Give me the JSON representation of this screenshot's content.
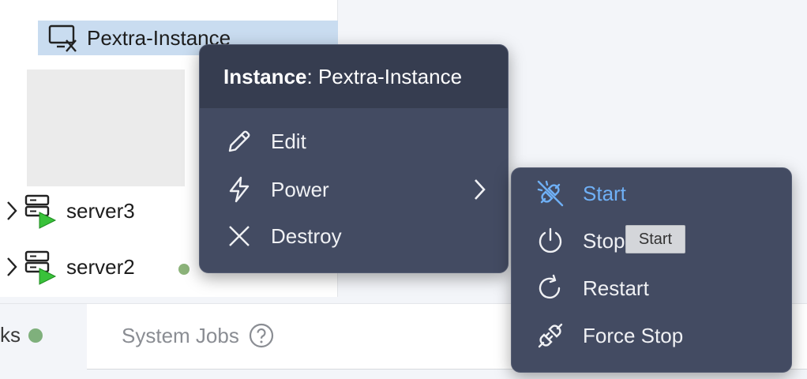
{
  "tree": {
    "selected_item": {
      "label": "Pextra-Instance",
      "icon": "monitor-x-icon"
    },
    "servers": [
      {
        "label": "server3",
        "icon": "server-running-icon"
      },
      {
        "label": "server2",
        "icon": "server-running-icon"
      }
    ]
  },
  "tabs": [
    {
      "label": "ks",
      "status": "green-dot"
    },
    {
      "label": "System Jobs",
      "icon": "help-circle-icon"
    }
  ],
  "context_menu": {
    "header_prefix": "Instance",
    "header_name": ": Pextra-Instance",
    "items": [
      {
        "label": "Edit",
        "icon": "pencil-icon"
      },
      {
        "label": "Power",
        "icon": "lightning-icon",
        "has_submenu": true
      },
      {
        "label": "Destroy",
        "icon": "x-icon"
      }
    ]
  },
  "power_submenu": {
    "items": [
      {
        "label": "Start",
        "icon": "plug-icon",
        "highlighted": true
      },
      {
        "label": "Stop",
        "icon": "power-icon"
      },
      {
        "label": "Restart",
        "icon": "restart-icon"
      },
      {
        "label": "Force Stop",
        "icon": "plug-disconnect-icon"
      }
    ]
  },
  "tooltip": {
    "text": "Start"
  },
  "colors": {
    "menu_bg": "#434b62",
    "menu_header_bg": "#363d50",
    "highlight": "#6fb0f6",
    "selected_row": "#c9dcf0",
    "status_green": "#7fb07c",
    "run_triangle": "#39c23a"
  }
}
